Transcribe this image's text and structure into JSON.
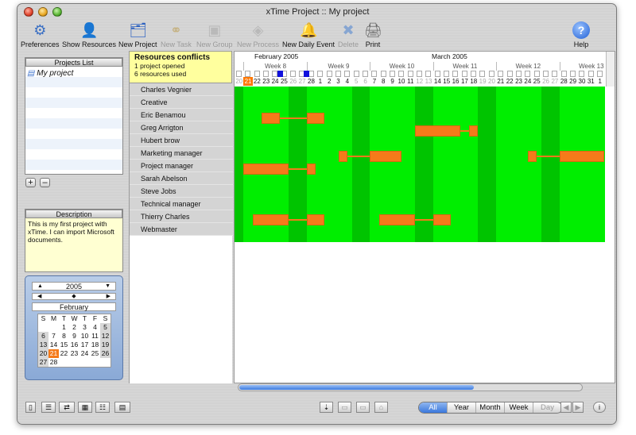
{
  "window": {
    "title": "xTime Project :: My project"
  },
  "toolbar": [
    {
      "label": "Preferences",
      "icon": "gears-icon",
      "enabled": true
    },
    {
      "label": "Show Resources",
      "icon": "person-icon",
      "enabled": true
    },
    {
      "label": "New Project",
      "icon": "new-project-icon",
      "enabled": true
    },
    {
      "label": "New Task",
      "icon": "task-icon",
      "enabled": false
    },
    {
      "label": "New Group",
      "icon": "group-icon",
      "enabled": false
    },
    {
      "label": "New Process",
      "icon": "process-icon",
      "enabled": false
    },
    {
      "label": "New Daily Event",
      "icon": "event-icon",
      "enabled": true
    },
    {
      "label": "Delete",
      "icon": "delete-icon",
      "enabled": false
    },
    {
      "label": "Print",
      "icon": "printer-icon",
      "enabled": true
    },
    {
      "label": "Help",
      "icon": "help-icon",
      "enabled": true
    }
  ],
  "projects": {
    "header": "Projects List",
    "items": [
      "My project"
    ],
    "add": "+",
    "remove": "–"
  },
  "description": {
    "header": "Description",
    "text": "This is my first project with xTime. I can import Microsoft documents."
  },
  "calendar": {
    "year": "2005",
    "month": "February",
    "weekdays": [
      "S",
      "M",
      "T",
      "W",
      "T",
      "F",
      "S"
    ],
    "weeks": [
      [
        "",
        "",
        "1",
        "2",
        "3",
        "4",
        "5"
      ],
      [
        "6",
        "7",
        "8",
        "9",
        "10",
        "11",
        "12"
      ],
      [
        "13",
        "14",
        "15",
        "16",
        "17",
        "18",
        "19"
      ],
      [
        "20",
        "21",
        "22",
        "23",
        "24",
        "25",
        "26"
      ],
      [
        "27",
        "28",
        "",
        "",
        "",
        "",
        ""
      ]
    ],
    "selected": "21"
  },
  "conflicts": {
    "title": "Resources conflicts",
    "lines": [
      "1 project opened",
      "6 resources used"
    ]
  },
  "resources": [
    "Charles Vegnier",
    "Creative",
    "Eric Benamou",
    "Greg Arrigton",
    "Hubert brow",
    "Marketing manager",
    "Project manager",
    "Sarah Abelson",
    "Steve Jobs",
    "Technical manager",
    "Thierry Charles",
    "Webmaster"
  ],
  "timeline": {
    "months": [
      "February 2005",
      "March 2005"
    ],
    "weeks": [
      "Week 8",
      "Week 9",
      "Week 10",
      "Week 11",
      "Week 12",
      "Week 13"
    ],
    "days": [
      "20",
      "21",
      "22",
      "23",
      "24",
      "25",
      "26",
      "27",
      "28",
      "1",
      "2",
      "3",
      "4",
      "5",
      "6",
      "7",
      "8",
      "9",
      "10",
      "11",
      "12",
      "13",
      "14",
      "15",
      "16",
      "17",
      "18",
      "19",
      "20",
      "21",
      "22",
      "23",
      "24",
      "25",
      "26",
      "27",
      "28",
      "29",
      "30",
      "31",
      "1"
    ],
    "today": "21"
  },
  "scale": {
    "options": [
      "All",
      "Year",
      "Month",
      "Week",
      "Day"
    ],
    "selected": "All"
  },
  "colors": {
    "free": "#00ee00",
    "weekend": "#00c400",
    "task": "#f57a1a",
    "conflict_header": "#ffff9e"
  }
}
